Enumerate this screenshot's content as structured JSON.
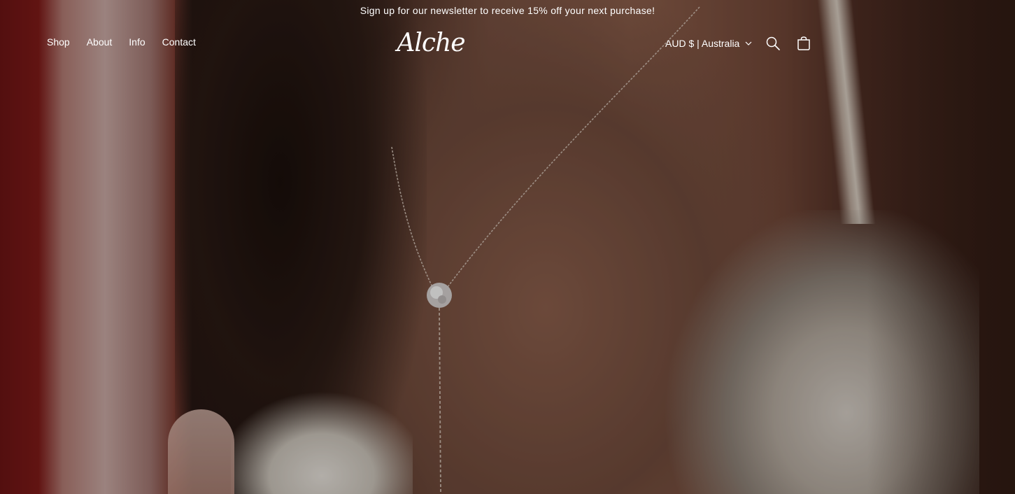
{
  "announcement": {
    "text": "Sign up for our newsletter to receive 15% off your next purchase!"
  },
  "header": {
    "nav": [
      {
        "label": "Shop"
      },
      {
        "label": "About"
      },
      {
        "label": "Info"
      },
      {
        "label": "Contact"
      }
    ],
    "logo_text": "Alche",
    "localization": {
      "label": "AUD $ | Australia"
    },
    "icons": {
      "search": "search-icon",
      "cart": "cart-icon",
      "chevron": "chevron-down-icon"
    }
  },
  "hero": {
    "image_description": "hero-photo"
  },
  "colors": {
    "text": "#ffffff",
    "overlay": "rgba(0,0,0,0.22)"
  }
}
